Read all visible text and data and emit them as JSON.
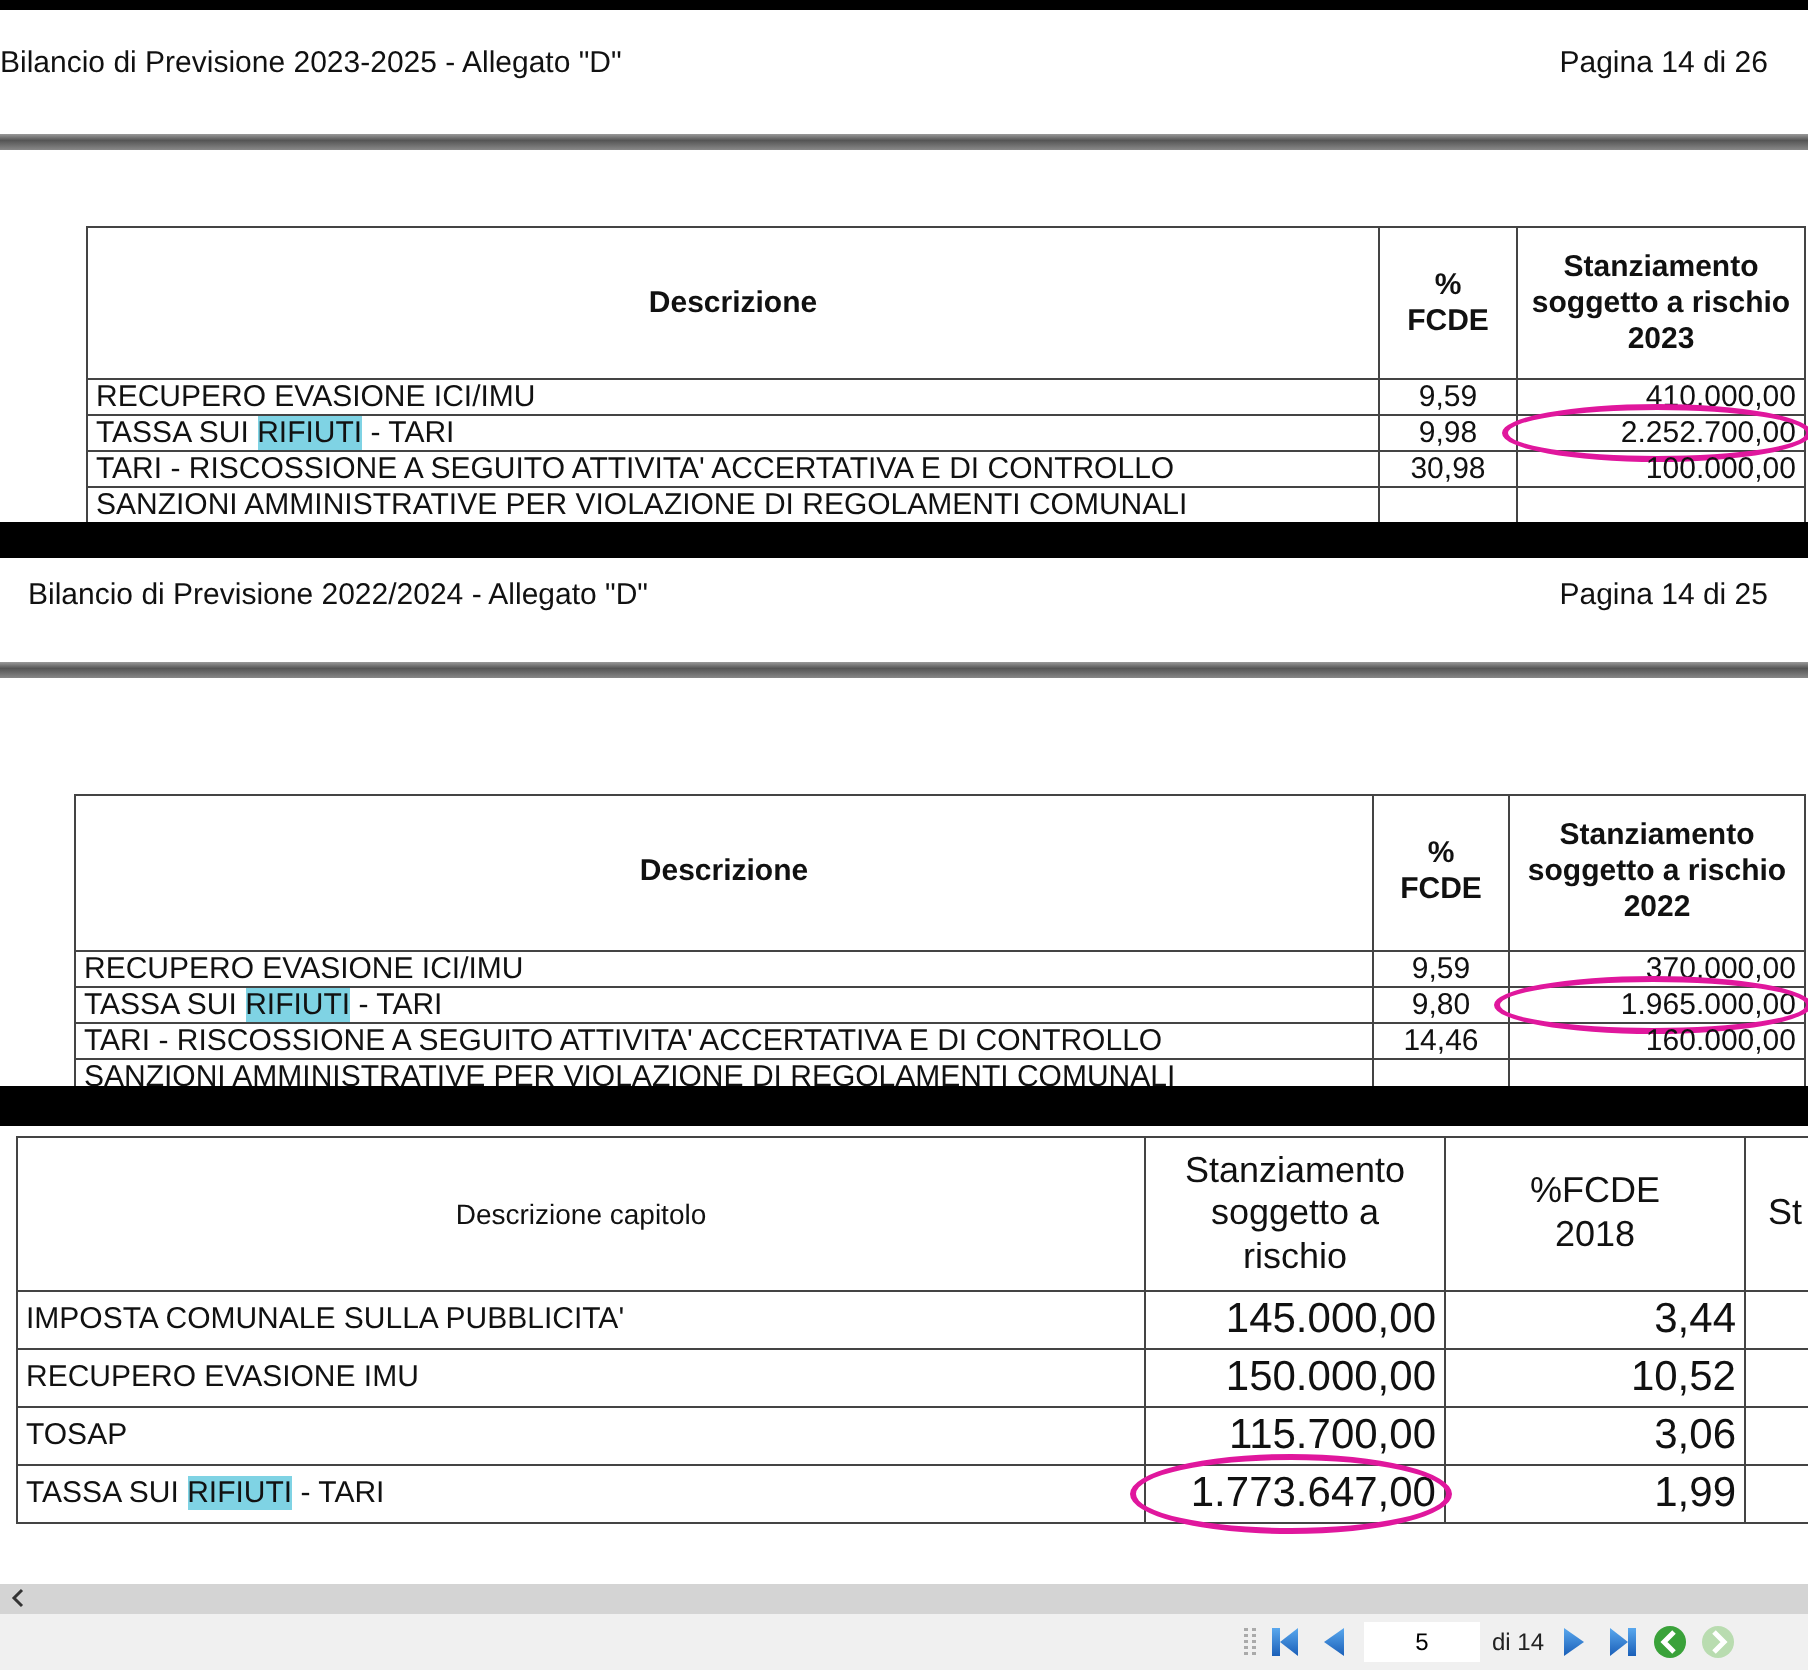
{
  "documents": [
    {
      "kind": "header",
      "title": "Bilancio di Previsione 2023-2025 - Allegato \"D\"",
      "page": "Pagina 14 di 26",
      "columns": [
        "Descrizione",
        "%\nFCDE",
        "Stanziamento soggetto a rischio 2023"
      ],
      "rows": [
        {
          "cells": [
            [
              {
                "text": "RECUPERO EVASIONE ICI/IMU",
                "highlighted": false
              }
            ],
            "9,59",
            "410.000,00"
          ],
          "circled": false
        },
        {
          "cells": [
            [
              {
                "text": "TASSA SUI ",
                "highlighted": false
              },
              {
                "text": "RIFIUTI",
                "highlighted": true
              },
              {
                "text": " - TARI",
                "highlighted": false
              }
            ],
            "9,98",
            "2.252.700,00"
          ],
          "circled": true
        },
        {
          "cells": [
            [
              {
                "text": "TARI - RISCOSSIONE A SEGUITO ATTIVITA' ACCERTATIVA E DI CONTROLLO",
                "highlighted": false
              }
            ],
            "30,98",
            "100.000,00"
          ],
          "circled": false
        },
        {
          "cells": [
            [
              {
                "text": "SANZIONI AMMINISTRATIVE PER VIOLAZIONE DI REGOLAMENTI COMUNALI",
                "highlighted": false
              }
            ],
            "",
            ""
          ],
          "circled": false
        }
      ]
    },
    {
      "kind": "header",
      "title": "Bilancio di Previsione 2022/2024 - Allegato \"D\"",
      "page": "Pagina 14 di 25",
      "columns": [
        "Descrizione",
        "%\nFCDE",
        "Stanziamento soggetto a rischio 2022"
      ],
      "rows": [
        {
          "cells": [
            [
              {
                "text": "RECUPERO EVASIONE ICI/IMU",
                "highlighted": false
              }
            ],
            "9,59",
            "370.000,00"
          ],
          "circled": false
        },
        {
          "cells": [
            [
              {
                "text": "TASSA SUI ",
                "highlighted": false
              },
              {
                "text": "RIFIUTI",
                "highlighted": true
              },
              {
                "text": " - TARI",
                "highlighted": false
              }
            ],
            "9,80",
            "1.965.000,00"
          ],
          "circled": true
        },
        {
          "cells": [
            [
              {
                "text": "TARI - RISCOSSIONE A SEGUITO ATTIVITA' ACCERTATIVA E DI CONTROLLO",
                "highlighted": false
              }
            ],
            "14,46",
            "160.000,00"
          ],
          "circled": false
        },
        {
          "cells": [
            [
              {
                "text": "SANZIONI AMMINISTRATIVE PER VIOLAZIONE DI REGOLAMENTI COMUNALI",
                "highlighted": false
              }
            ],
            "",
            ""
          ],
          "circled": false
        }
      ]
    },
    {
      "kind": "plain",
      "columns": [
        "Descrizione capitolo",
        "Stanziamento soggetto a rischio",
        "%FCDE\n2018",
        "St"
      ],
      "rows": [
        {
          "cells": [
            [
              {
                "text": "IMPOSTA COMUNALE SULLA PUBBLICITA'",
                "highlighted": false
              }
            ],
            "145.000,00",
            "3,44",
            ""
          ],
          "circled": false
        },
        {
          "cells": [
            [
              {
                "text": "RECUPERO EVASIONE IMU",
                "highlighted": false
              }
            ],
            "150.000,00",
            "10,52",
            ""
          ],
          "circled": false
        },
        {
          "cells": [
            [
              {
                "text": "TOSAP",
                "highlighted": false
              }
            ],
            "115.700,00",
            "3,06",
            ""
          ],
          "circled": false
        },
        {
          "cells": [
            [
              {
                "text": "TASSA SUI ",
                "highlighted": false
              },
              {
                "text": "RIFIUTI",
                "highlighted": true
              },
              {
                "text": " - TARI",
                "highlighted": false
              }
            ],
            "1.773.647,00",
            "1,99",
            ""
          ],
          "circled": true
        }
      ]
    }
  ],
  "viewer": {
    "page_value": "5",
    "page_count": "di 14",
    "forward_disabled": true
  }
}
